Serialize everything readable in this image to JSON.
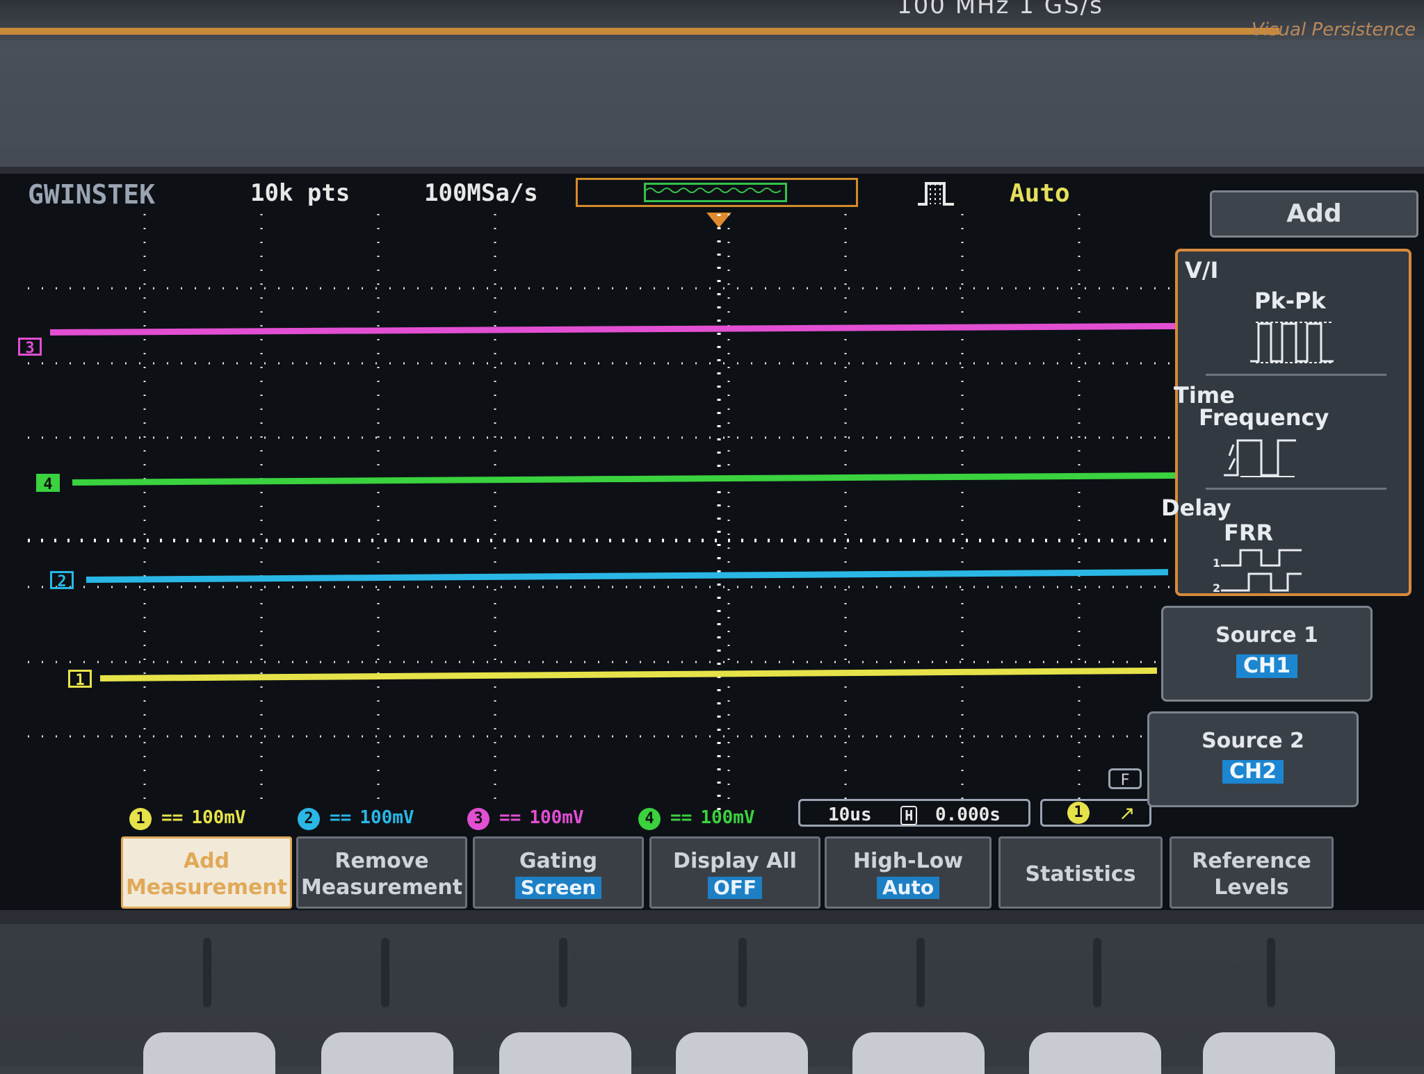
{
  "device": {
    "spec": "100 MHz   1 GS/s",
    "visual_persistence": "Visual Persistence"
  },
  "header": {
    "brand": "GWINSTEK",
    "record_length": "10k pts",
    "sample_rate": "100MSa/s",
    "trigger_mode": "Auto"
  },
  "markers": {
    "ch1": "1",
    "ch2": "2",
    "ch3": "3",
    "ch4": "4"
  },
  "channels": [
    {
      "num": "1",
      "coupling": "==",
      "scale": "100mV",
      "color": "#e6e34a"
    },
    {
      "num": "2",
      "coupling": "==",
      "scale": "100mV",
      "color": "#2ab7e6"
    },
    {
      "num": "3",
      "coupling": "==",
      "scale": "100mV",
      "color": "#e24fd3"
    },
    {
      "num": "4",
      "coupling": "==",
      "scale": "100mV",
      "color": "#3ad23e"
    }
  ],
  "timebase": {
    "scale": "10us",
    "position": "0.000s",
    "h_icon": "H"
  },
  "trigger": {
    "source": "1",
    "slope": "↗"
  },
  "filter_label": "F",
  "softkeys": {
    "add_measurement": "Add Measurement",
    "remove_measurement": "Remove Measurement",
    "gating_label": "Gating",
    "gating_value": "Screen",
    "display_all_label": "Display All",
    "display_all_value": "OFF",
    "high_low_label": "High-Low",
    "high_low_value": "Auto",
    "statistics": "Statistics",
    "reference_levels": "Reference Levels"
  },
  "right_menu": {
    "title": "Add",
    "vi": "V/I",
    "pkpk": "Pk-Pk",
    "time": "Time",
    "frequency": "Frequency",
    "delay": "Delay",
    "frr": "FRR",
    "source1_label": "Source 1",
    "source1_value": "CH1",
    "source2_label": "Source 2",
    "source2_value": "CH2"
  }
}
